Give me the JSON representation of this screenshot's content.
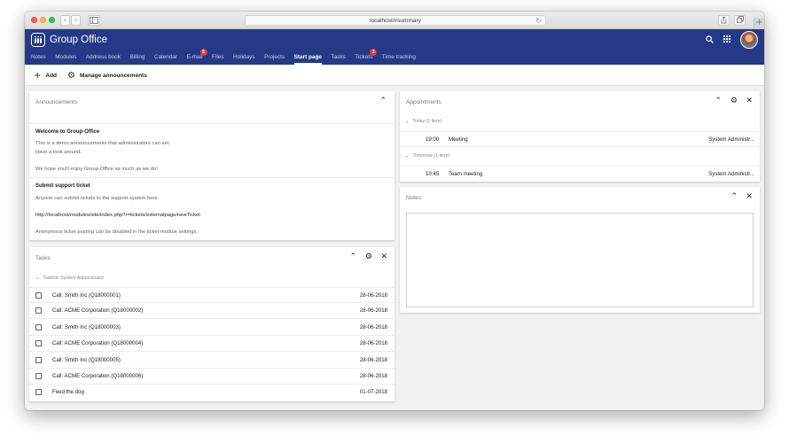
{
  "browser": {
    "url": "localhost/#summary",
    "back_glyph": "‹",
    "forward_glyph": "›",
    "reload_glyph": "↻",
    "new_tab_glyph": "+"
  },
  "app": {
    "title": "Group Office",
    "nav_tabs": [
      {
        "label": "Notes",
        "badge": ""
      },
      {
        "label": "Modules",
        "badge": ""
      },
      {
        "label": "Address book",
        "badge": ""
      },
      {
        "label": "Billing",
        "badge": ""
      },
      {
        "label": "Calendar",
        "badge": ""
      },
      {
        "label": "E-mail",
        "badge": "5"
      },
      {
        "label": "Files",
        "badge": ""
      },
      {
        "label": "Holidays",
        "badge": ""
      },
      {
        "label": "Projects",
        "badge": ""
      },
      {
        "label": "Start page",
        "badge": "",
        "active": true
      },
      {
        "label": "Tasks",
        "badge": ""
      },
      {
        "label": "Tickets",
        "badge": "3"
      },
      {
        "label": "Time tracking",
        "badge": ""
      }
    ],
    "accent_color": "#243a86",
    "badge_color": "#e53935"
  },
  "toolbar": {
    "add_label": "Add",
    "manage_label": "Manage announcements"
  },
  "announcements": {
    "title": "Announcements",
    "items": [
      {
        "heading": "Welcome to Group-Office",
        "lines": [
          "This is a demo announcements that administrators can set.",
          "Have a look around.",
          "",
          "We hope you'll enjoy Group-Office as much as we do!"
        ]
      },
      {
        "heading": "Submit support ticket",
        "lines": [
          "Anyone can submit tickets to the support system here:",
          "",
          "http://localhost/modules/site/index.php?r=tickets/externalpage/newTicket",
          "",
          "Anonymous ticket posting can be disabled in the ticket module settings."
        ]
      }
    ]
  },
  "tasks": {
    "title": "Tasks",
    "group_label": "Tasklist: System Administrator",
    "rows": [
      {
        "name": "Call: Smith Inc (Q18000001)",
        "date": "28-06-2018"
      },
      {
        "name": "Call: ACME Corporation (Q18000002)",
        "date": "28-06-2018"
      },
      {
        "name": "Call: Smith Inc (Q18000003)",
        "date": "28-06-2018"
      },
      {
        "name": "Call: ACME Corporation (Q18000004)",
        "date": "28-06-2018"
      },
      {
        "name": "Call: Smith Inc (Q18000005)",
        "date": "28-06-2018"
      },
      {
        "name": "Call: ACME Corporation (Q18000006)",
        "date": "28-06-2018"
      },
      {
        "name": "Feed the dog",
        "date": "01-07-2018"
      }
    ]
  },
  "appointments": {
    "title": "Appointments",
    "groups": [
      {
        "label": "Today (1 item)",
        "items": [
          {
            "time": "19:00",
            "subject": "Meeting",
            "owner": "System Administr..."
          }
        ]
      },
      {
        "label": "Tomorrow (1 item)",
        "items": [
          {
            "time": "10:45",
            "subject": "Team meeting",
            "owner": "System Administr..."
          }
        ]
      }
    ]
  },
  "notes": {
    "title": "Notes",
    "content": ""
  }
}
